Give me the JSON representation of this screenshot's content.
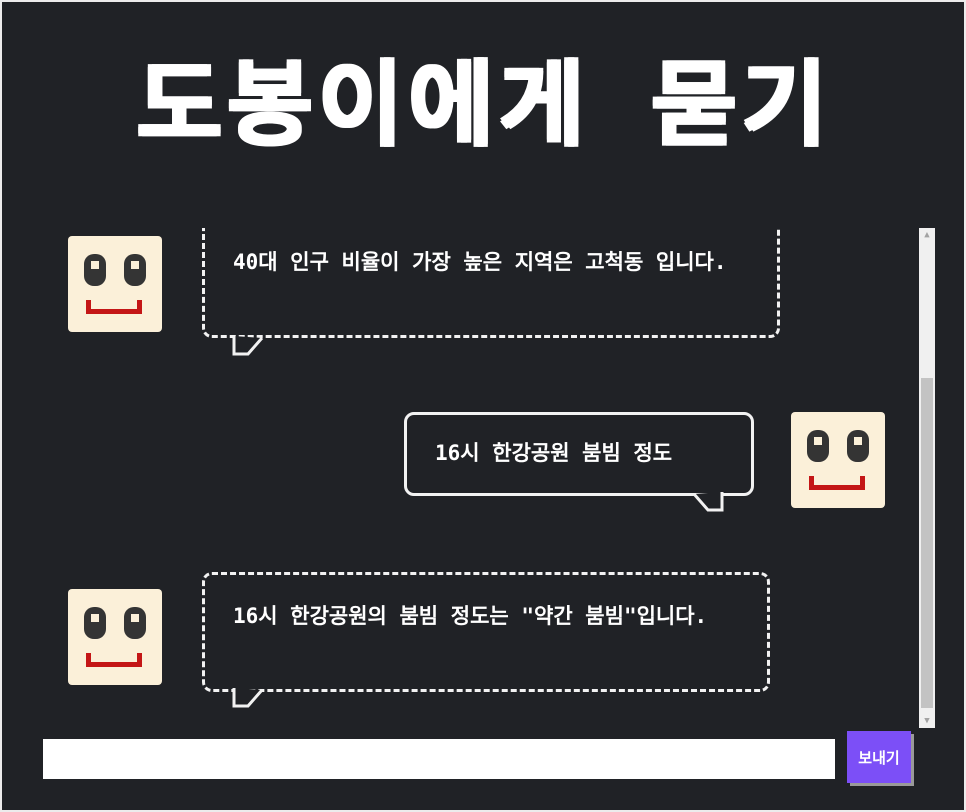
{
  "title": "도봉이에게 묻기",
  "messages": [
    {
      "sender": "bot",
      "text": "40대 인구 비율이 가장 높은 지역은 고척동 입니다."
    },
    {
      "sender": "user",
      "text": "16시 한강공원 붐빔 정도"
    },
    {
      "sender": "bot",
      "text": "16시 한강공원의 붐빔 정도는 \"약간 붐빔\"입니다."
    }
  ],
  "input": {
    "placeholder": "",
    "value": ""
  },
  "send_label": "보내기",
  "colors": {
    "background": "#202226",
    "accent": "#7c4ff7",
    "avatar": "#fbf0d9",
    "smile": "#c41616"
  }
}
